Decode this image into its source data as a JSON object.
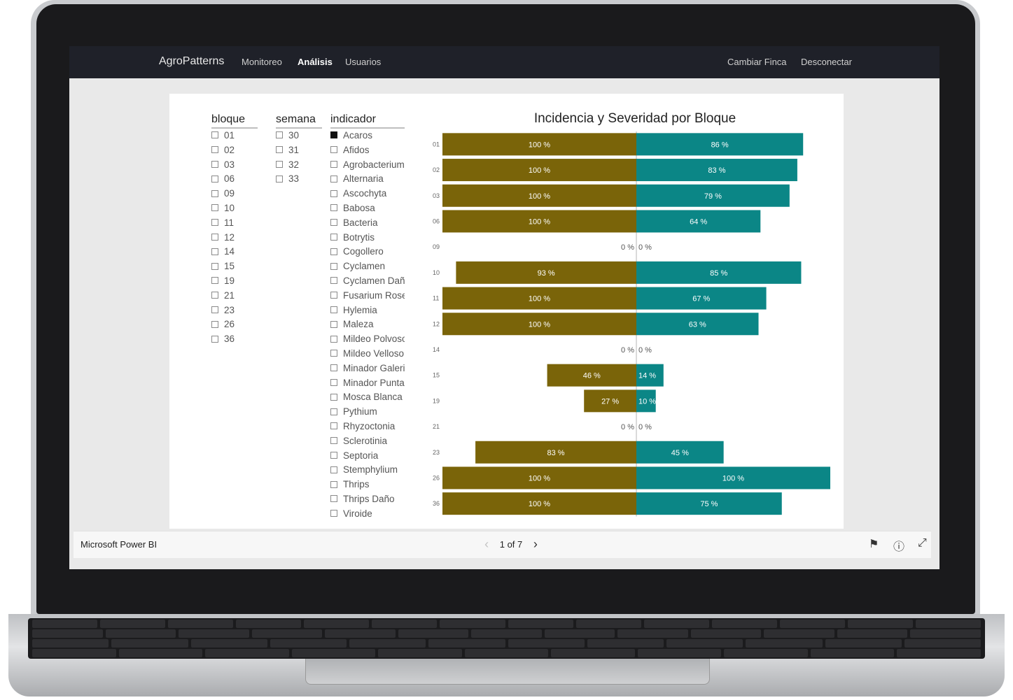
{
  "navbar": {
    "brand": "AgroPatterns",
    "links": [
      "Monitoreo",
      "Análisis",
      "Usuarios"
    ],
    "active": "Análisis",
    "right_links": [
      "Cambiar Finca",
      "Desconectar"
    ]
  },
  "slicers": {
    "bloque": {
      "title": "bloque",
      "items": [
        "01",
        "02",
        "03",
        "06",
        "09",
        "10",
        "11",
        "12",
        "14",
        "15",
        "19",
        "21",
        "23",
        "26",
        "36"
      ]
    },
    "semana": {
      "title": "semana",
      "items": [
        "30",
        "31",
        "32",
        "33"
      ]
    },
    "indicador": {
      "title": "indicador",
      "selected": "Acaros",
      "items": [
        "Acaros",
        "Afidos",
        "Agrobacterium",
        "Alternaria",
        "Ascochyta",
        "Babosa",
        "Bacteria",
        "Botrytis",
        "Cogollero",
        "Cyclamen",
        "Cyclamen Daño",
        "Fusarium Rose...",
        "Hylemia",
        "Maleza",
        "Mildeo Polvoso",
        "Mildeo Velloso",
        "Minador Galeria",
        "Minador Punta",
        "Mosca Blanca",
        "Pythium",
        "Rhyzoctonia",
        "Sclerotinia",
        "Septoria",
        "Stemphylium",
        "Thrips",
        "Thrips Daño",
        "Viroide"
      ]
    }
  },
  "chart_data": {
    "type": "bar",
    "title": "Incidencia y  Severidad por Bloque",
    "categories": [
      "01",
      "02",
      "03",
      "06",
      "09",
      "10",
      "11",
      "12",
      "14",
      "15",
      "19",
      "21",
      "23",
      "26",
      "36"
    ],
    "series": [
      {
        "values": [
          100,
          100,
          100,
          100,
          0,
          93,
          100,
          100,
          0,
          46,
          27,
          0,
          83,
          100,
          100
        ],
        "color": "#7a6409"
      },
      {
        "values": [
          86,
          83,
          79,
          64,
          0,
          85,
          67,
          63,
          0,
          14,
          10,
          0,
          45,
          100,
          75
        ],
        "color": "#0b8686"
      }
    ],
    "label_suffix": " %",
    "orientation": "horizontal-butterfly"
  },
  "footer": {
    "brand": "Microsoft Power BI",
    "page_indicator": "1 of 7",
    "icons": [
      "flag-icon",
      "info-icon",
      "expand-icon"
    ]
  },
  "colors": {
    "navbar": "#1f2129",
    "incidencia": "#7a6409",
    "severidad": "#0b8686"
  }
}
